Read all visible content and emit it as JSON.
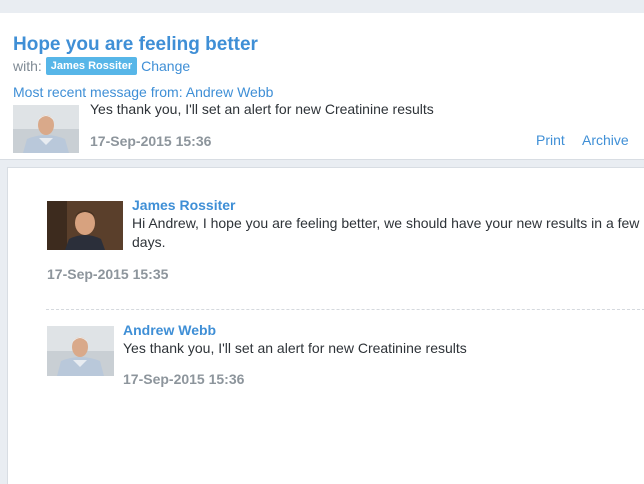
{
  "thread": {
    "title": "Hope you are feeling better",
    "with_label": "with:",
    "participant": "James Rossiter",
    "change_label": "Change"
  },
  "recent": {
    "label": "Most recent message from: Andrew Webb",
    "text": "Yes thank you, I'll set an alert for new Creatinine results",
    "time": "17-Sep-2015 15:36",
    "print_label": "Print",
    "archive_label": "Archive",
    "avatar_icon": "elderly-man-avatar"
  },
  "messages": [
    {
      "sender": "James Rossiter",
      "body": "Hi Andrew, I hope you are feeling better, we should have your new results in a few days.",
      "time": "17-Sep-2015 15:35",
      "avatar_icon": "young-man-avatar"
    },
    {
      "sender": "Andrew Webb",
      "body": "Yes thank you, I'll set an alert for new Creatinine results",
      "time": "17-Sep-2015 15:36",
      "avatar_icon": "elderly-man-avatar"
    }
  ],
  "colors": {
    "accent": "#3f8fd6",
    "tag": "#57b6e8",
    "muted": "#8d959c",
    "text": "#2e3338"
  }
}
